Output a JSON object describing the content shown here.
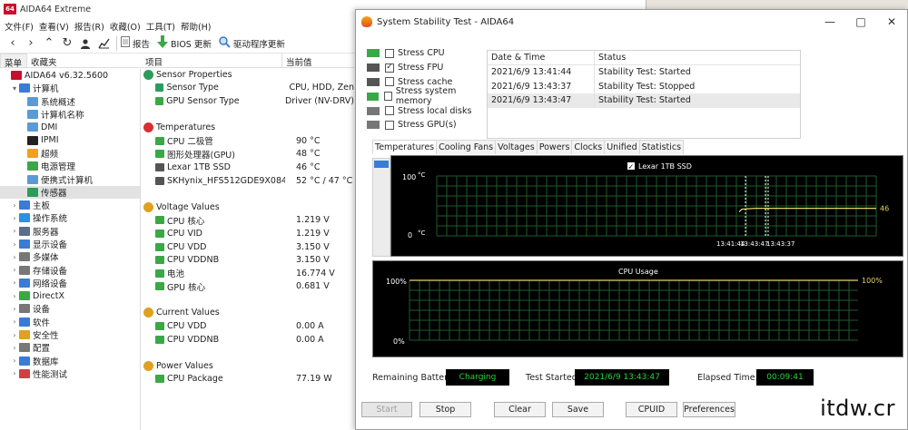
{
  "main": {
    "title": "AIDA64 Extreme",
    "logo": "64",
    "menu": [
      "文件(F)",
      "查看(V)",
      "报告(R)",
      "收藏(O)",
      "工具(T)",
      "帮助(H)"
    ],
    "toolbar": {
      "report_label": "报告",
      "bios_label": "BIOS 更新",
      "driver_label": "驱动程序更新"
    },
    "panel_tabs": [
      "菜单",
      "收藏夹"
    ],
    "tree": [
      {
        "label": "AIDA64 v6.32.5600",
        "level": 0,
        "expander": "",
        "color": "#c8102e"
      },
      {
        "label": "计算机",
        "level": 1,
        "expander": "▾",
        "color": "#3a7bd5"
      },
      {
        "label": "系统概述",
        "level": 2,
        "expander": "",
        "color": "#5b9bd5"
      },
      {
        "label": "计算机名称",
        "level": 2,
        "expander": "",
        "color": "#5b9bd5"
      },
      {
        "label": "DMI",
        "level": 2,
        "expander": "",
        "color": "#5b9bd5"
      },
      {
        "label": "IPMI",
        "level": 2,
        "expander": "",
        "color": "#222222"
      },
      {
        "label": "超频",
        "level": 2,
        "expander": "",
        "color": "#f0a020"
      },
      {
        "label": "电源管理",
        "level": 2,
        "expander": "",
        "color": "#3aa845"
      },
      {
        "label": "便携式计算机",
        "level": 2,
        "expander": "",
        "color": "#5b9bd5"
      },
      {
        "label": "传感器",
        "level": 2,
        "expander": "",
        "color": "#2d9c5b",
        "selected": true
      },
      {
        "label": "主板",
        "level": 1,
        "expander": "›",
        "color": "#3a7bd5"
      },
      {
        "label": "操作系统",
        "level": 1,
        "expander": "›",
        "color": "#2f8fe0"
      },
      {
        "label": "服务器",
        "level": 1,
        "expander": "›",
        "color": "#5a6e8c"
      },
      {
        "label": "显示设备",
        "level": 1,
        "expander": "›",
        "color": "#3a7bd5"
      },
      {
        "label": "多媒体",
        "level": 1,
        "expander": "›",
        "color": "#777777"
      },
      {
        "label": "存储设备",
        "level": 1,
        "expander": "›",
        "color": "#777777"
      },
      {
        "label": "网络设备",
        "level": 1,
        "expander": "›",
        "color": "#3a7bd5"
      },
      {
        "label": "DirectX",
        "level": 1,
        "expander": "›",
        "color": "#3aa845"
      },
      {
        "label": "设备",
        "level": 1,
        "expander": "›",
        "color": "#777777"
      },
      {
        "label": "软件",
        "level": 1,
        "expander": "›",
        "color": "#3a7bd5"
      },
      {
        "label": "安全性",
        "level": 1,
        "expander": "›",
        "color": "#e0a020"
      },
      {
        "label": "配置",
        "level": 1,
        "expander": "›",
        "color": "#777777"
      },
      {
        "label": "数据库",
        "level": 1,
        "expander": "›",
        "color": "#3a7bd5"
      },
      {
        "label": "性能测试",
        "level": 1,
        "expander": "›",
        "color": "#d04040"
      }
    ],
    "columns": {
      "item": "项目",
      "value": "当前值"
    },
    "sections": [
      {
        "title": "Sensor Properties",
        "icon_color": "#2d9c5b",
        "rows": [
          {
            "name": "Sensor Type",
            "value": "CPU, HDD, Zen",
            "color": "#2d9c5b"
          },
          {
            "name": "GPU Sensor Type",
            "value": "Driver  (NV-DRV)",
            "color": "#3aa845"
          }
        ]
      },
      {
        "title": "Temperatures",
        "icon_color": "#d83030",
        "rows": [
          {
            "name": "CPU 二极管",
            "value": "90 °C",
            "color": "#3aa845"
          },
          {
            "name": "图形处理器(GPU)",
            "value": "48 °C",
            "color": "#3aa845"
          },
          {
            "name": "Lexar 1TB SSD",
            "value": "46 °C",
            "color": "#555555"
          },
          {
            "name": "SKHynix_HFS512GDE9X084N",
            "value": "52 °C / 47 °C",
            "color": "#555555"
          }
        ]
      },
      {
        "title": "Voltage Values",
        "icon_color": "#e0a020",
        "rows": [
          {
            "name": "CPU 核心",
            "value": "1.219 V",
            "color": "#3aa845"
          },
          {
            "name": "CPU VID",
            "value": "1.219 V",
            "color": "#3aa845"
          },
          {
            "name": "CPU VDD",
            "value": "3.150 V",
            "color": "#3aa845"
          },
          {
            "name": "CPU VDDNB",
            "value": "3.150 V",
            "color": "#3aa845"
          },
          {
            "name": "电池",
            "value": "16.774 V",
            "color": "#3aa845"
          },
          {
            "name": "GPU 核心",
            "value": "0.681 V",
            "color": "#3aa845"
          }
        ]
      },
      {
        "title": "Current Values",
        "icon_color": "#e0a020",
        "rows": [
          {
            "name": "CPU VDD",
            "value": "0.00 A",
            "color": "#3aa845"
          },
          {
            "name": "CPU VDDNB",
            "value": "0.00 A",
            "color": "#3aa845"
          }
        ]
      },
      {
        "title": "Power Values",
        "icon_color": "#e0a020",
        "rows": [
          {
            "name": "CPU Package",
            "value": "77.19 W",
            "color": "#3aa845"
          }
        ]
      }
    ]
  },
  "dialog": {
    "title": "System Stability Test - AIDA64",
    "stress_items": [
      {
        "label": "Stress CPU",
        "checked": false,
        "color": "#3aa845"
      },
      {
        "label": "Stress FPU",
        "checked": true,
        "color": "#555555"
      },
      {
        "label": "Stress cache",
        "checked": false,
        "color": "#555555"
      },
      {
        "label": "Stress system memory",
        "checked": false,
        "color": "#3aa845"
      },
      {
        "label": "Stress local disks",
        "checked": false,
        "color": "#777777"
      },
      {
        "label": "Stress GPU(s)",
        "checked": false,
        "color": "#777777"
      }
    ],
    "check_mark": "✓",
    "table": {
      "headers": [
        "Date & Time",
        "Status"
      ],
      "rows": [
        {
          "time": "2021/6/9 13:41:44",
          "status": "Stability Test: Started",
          "selected": false
        },
        {
          "time": "2021/6/9 13:43:37",
          "status": "Stability Test: Stopped",
          "selected": false
        },
        {
          "time": "2021/6/9 13:43:47",
          "status": "Stability Test: Started",
          "selected": true
        }
      ]
    },
    "tabs": [
      "Temperatures",
      "Cooling Fans",
      "Voltages",
      "Powers",
      "Clocks",
      "Unified",
      "Statistics"
    ],
    "temp_graph": {
      "legend": "Lexar 1TB SSD",
      "legend_checked": true,
      "y_max_label": "100",
      "y_min_label": "0",
      "unit": "°C",
      "current_value": "46",
      "value": 46,
      "markers": [
        "13:41:44",
        "13:43:47",
        "13:43:37"
      ]
    },
    "cpu_graph": {
      "title": "CPU Usage",
      "y_max_label": "100%",
      "y_min_label": "0%",
      "current_value": "100%",
      "value": 100
    },
    "info": {
      "battery_label": "Remaining Battery:",
      "battery_value": "Charging",
      "started_label": "Test Started:",
      "started_value": "2021/6/9 13:43:47",
      "elapsed_label": "Elapsed Time:",
      "elapsed_value": "00:09:41"
    },
    "buttons": {
      "start": "Start",
      "stop": "Stop",
      "clear": "Clear",
      "save": "Save",
      "cpuid": "CPUID",
      "preferences": "Preferences"
    }
  },
  "watermark": "itdw.cr"
}
